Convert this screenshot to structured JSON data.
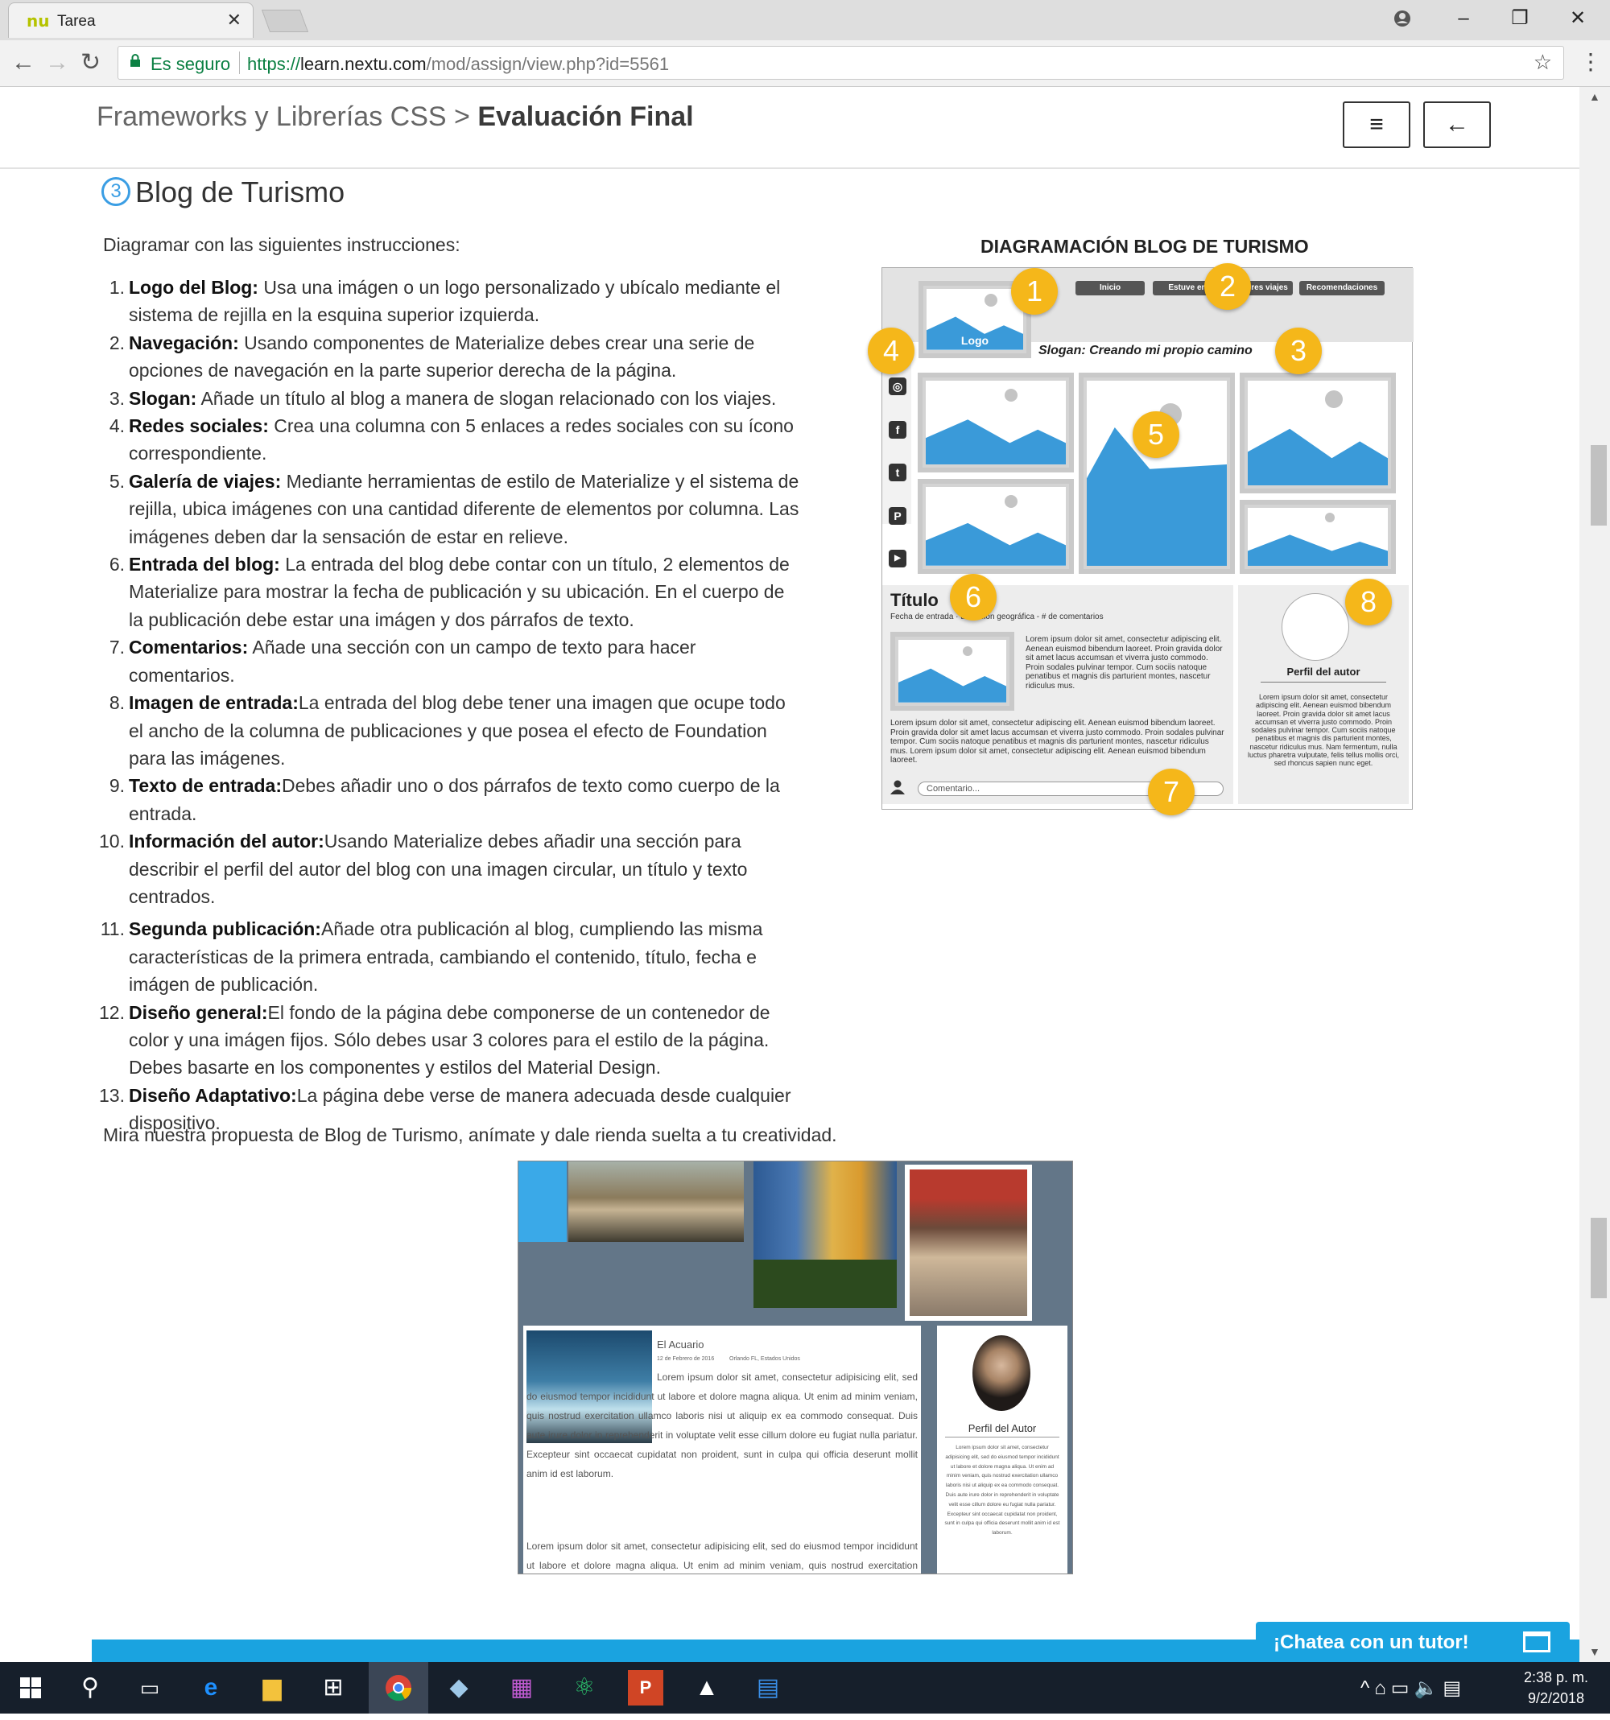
{
  "browser": {
    "tab_title": "Tarea",
    "tab_favicon": "nu",
    "secure_label": "Es seguro",
    "url_scheme": "https://",
    "url_host": "learn.nextu.com",
    "url_path": "/mod/assign/view.php?id=5561"
  },
  "header": {
    "breadcrumb_parent": "Frameworks y Librerías CSS",
    "breadcrumb_sep": ">",
    "breadcrumb_current": "Evaluación Final",
    "menu_icon": "≡",
    "back_icon": "←"
  },
  "section": {
    "number": "3",
    "title": "Blog de Turismo",
    "intro": "Diagramar con las siguientes instrucciones:",
    "items": [
      {
        "n": "1.",
        "bold": "Logo del Blog:",
        "text": " Usa una imágen o un logo personalizado y ubícalo mediante el sistema de rejilla en la esquina superior izquierda."
      },
      {
        "n": "2.",
        "bold": "Navegación:",
        "text": " Usando componentes de Materialize debes crear una serie de opciones de navegación en la parte superior derecha de la página."
      },
      {
        "n": "3.",
        "bold": "Slogan:",
        "text": " Añade un título al blog a manera de slogan relacionado con los viajes."
      },
      {
        "n": "4.",
        "bold": "Redes sociales:",
        "text": " Crea una columna con 5 enlaces a redes sociales con su ícono correspondiente."
      },
      {
        "n": "5.",
        "bold": "Galería de viajes:",
        "text": " Mediante herramientas de estilo de Materialize y el sistema de rejilla, ubica imágenes con una cantidad diferente de elementos por columna. Las imágenes deben dar la sensación de estar en relieve."
      },
      {
        "n": "6.",
        "bold": "Entrada del blog:",
        "text": " La entrada del blog debe contar con un título, 2 elementos de Materialize para mostrar la fecha de publicación y su ubicación. En el cuerpo de la publicación debe estar una imágen y dos párrafos de texto."
      },
      {
        "n": "7.",
        "bold": "Comentarios:",
        "text": " Añade una sección con un campo de texto para hacer comentarios."
      },
      {
        "n": "8.",
        "bold": "Imagen de entrada:",
        "text": "La entrada del blog debe tener una imagen que ocupe todo el ancho de la columna de publicaciones y que posea el efecto de Foundation para las imágenes."
      },
      {
        "n": "9.",
        "bold": "Texto de entrada:",
        "text": "Debes añadir uno o dos párrafos de texto como cuerpo de la entrada."
      },
      {
        "n": "10.",
        "bold": "Información del autor:",
        "text": "Usando Materialize debes añadir una sección para describir el perfil del autor del blog con una imagen circular, un título y texto centrados."
      },
      {
        "n": "11.",
        "bold": "Segunda publicación:",
        "text": "Añade otra publicación al blog, cumpliendo las misma características de la primera entrada, cambiando el contenido, título, fecha e imágen de publicación."
      },
      {
        "n": "12.",
        "bold": "Diseño general:",
        "text": "El fondo de la página debe componerse de un contenedor de color y una imágen fijos. Sólo debes usar 3 colores para el estilo de la página. Debes basarte en los componentes y estilos del Material Design."
      },
      {
        "n": "13.",
        "bold": "Diseño Adaptativo:",
        "text": "La página debe verse de manera adecuada desde cualquier dispositivo."
      }
    ],
    "outro": "Mira nuestra propuesta de Blog de Turismo, anímate y dale rienda suelta a tu creatividad."
  },
  "diagram": {
    "title": "DIAGRAMACIÓN BLOG DE TURISMO",
    "logo": "Logo",
    "nav": [
      "Inicio",
      "Estuve en",
      "ores viajes",
      "Recomendaciones"
    ],
    "slogan": "Slogan: Creando mi propio camino",
    "badges": [
      "1",
      "2",
      "3",
      "4",
      "5",
      "6",
      "7",
      "8"
    ],
    "post_title": "Título",
    "post_meta": "Fecha de entrada · ubicación geográfica - # de comentarios",
    "post_side_text": "Lorem ipsum dolor sit amet, consectetur adipiscing elit. Aenean euismod bibendum laoreet. Proin gravida dolor sit amet lacus accumsan et viverra justo commodo. Proin sodales pulvinar tempor. Cum sociis natoque penatibus et magnis dis parturient montes, nascetur ridiculus mus.",
    "post_text": "Lorem ipsum dolor sit amet, consectetur adipiscing elit. Aenean euismod bibendum laoreet. Proin gravida dolor sit amet lacus accumsan et viverra justo commodo. Proin sodales pulvinar tempor. Cum sociis natoque penatibus et magnis dis parturient montes, nascetur ridiculus mus. Lorem ipsum dolor sit amet, consectetur adipiscing elit. Aenean euismod bibendum laoreet.",
    "comment_placeholder": "Comentario...",
    "author_title": "Perfil del autor",
    "author_text": "Lorem ipsum dolor sit amet, consectetur adipiscing elit. Aenean euismod bibendum laoreet. Proin gravida dolor sit amet lacus accumsan et viverra justo commodo. Proin sodales pulvinar tempor. Cum sociis natoque penatibus et magnis dis parturient montes, nascetur ridiculus mus. Nam fermentum, nulla luctus pharetra vulputate, felis tellus mollis orci, sed rhoncus sapien nunc eget.",
    "colors": {
      "image_blue": "#3a9ad9",
      "badge": "#f5b71a",
      "frame": "#c9c9c9"
    }
  },
  "example": {
    "post_title": "El Acuario",
    "post_date": "12 de Febrero de 2016",
    "post_place": "Orlando FL, Estados Unidos",
    "post_text_1": "Lorem ipsum dolor sit amet, consectetur adipisicing elit, sed do eiusmod tempor incididunt ut labore et dolore magna aliqua. Ut enim ad minim veniam, quis nostrud exercitation ullamco laboris nisi ut aliquip ex ea commodo consequat. Duis aute irure dolor in reprehenderit in voluptate velit esse cillum dolore eu fugiat nulla pariatur. Excepteur sint occaecat cupidatat non proident, sunt in culpa qui officia deserunt mollit anim id est laborum.",
    "post_text_2": "Lorem ipsum dolor sit amet, consectetur adipisicing elit, sed do eiusmod tempor incididunt ut labore et dolore magna aliqua. Ut enim ad minim veniam, quis nostrud exercitation ullamco laboris nisi ut aliquip ex ea commodo consequat. Duis aute irure dolor in",
    "author_title": "Perfil del Autor",
    "author_text": "Lorem ipsum dolor sit amet, consectetur adipisicing elit, sed do eiusmod tempor incididunt ut labore et dolore magna aliqua. Ut enim ad minim veniam, quis nostrud exercitation ullamco laboris nisi ut aliquip ex ea commodo consequat. Duis aute irure dolor in reprehenderit in voluptate velit esse cillum dolore eu fugiat nulla pariatur. Excepteur sint occaecat cupidatat non proident, sunt in culpa qui officia deserunt mollit anim id est laborum."
  },
  "chat": {
    "label": "¡Chatea con un tutor!"
  },
  "taskbar": {
    "time": "2:38 p. m.",
    "date": "9/2/2018"
  },
  "icons": {
    "back": "arrow-left-icon",
    "forward": "arrow-right-icon",
    "reload": "reload-icon",
    "bookmark": "star-icon",
    "account": "account-icon"
  }
}
